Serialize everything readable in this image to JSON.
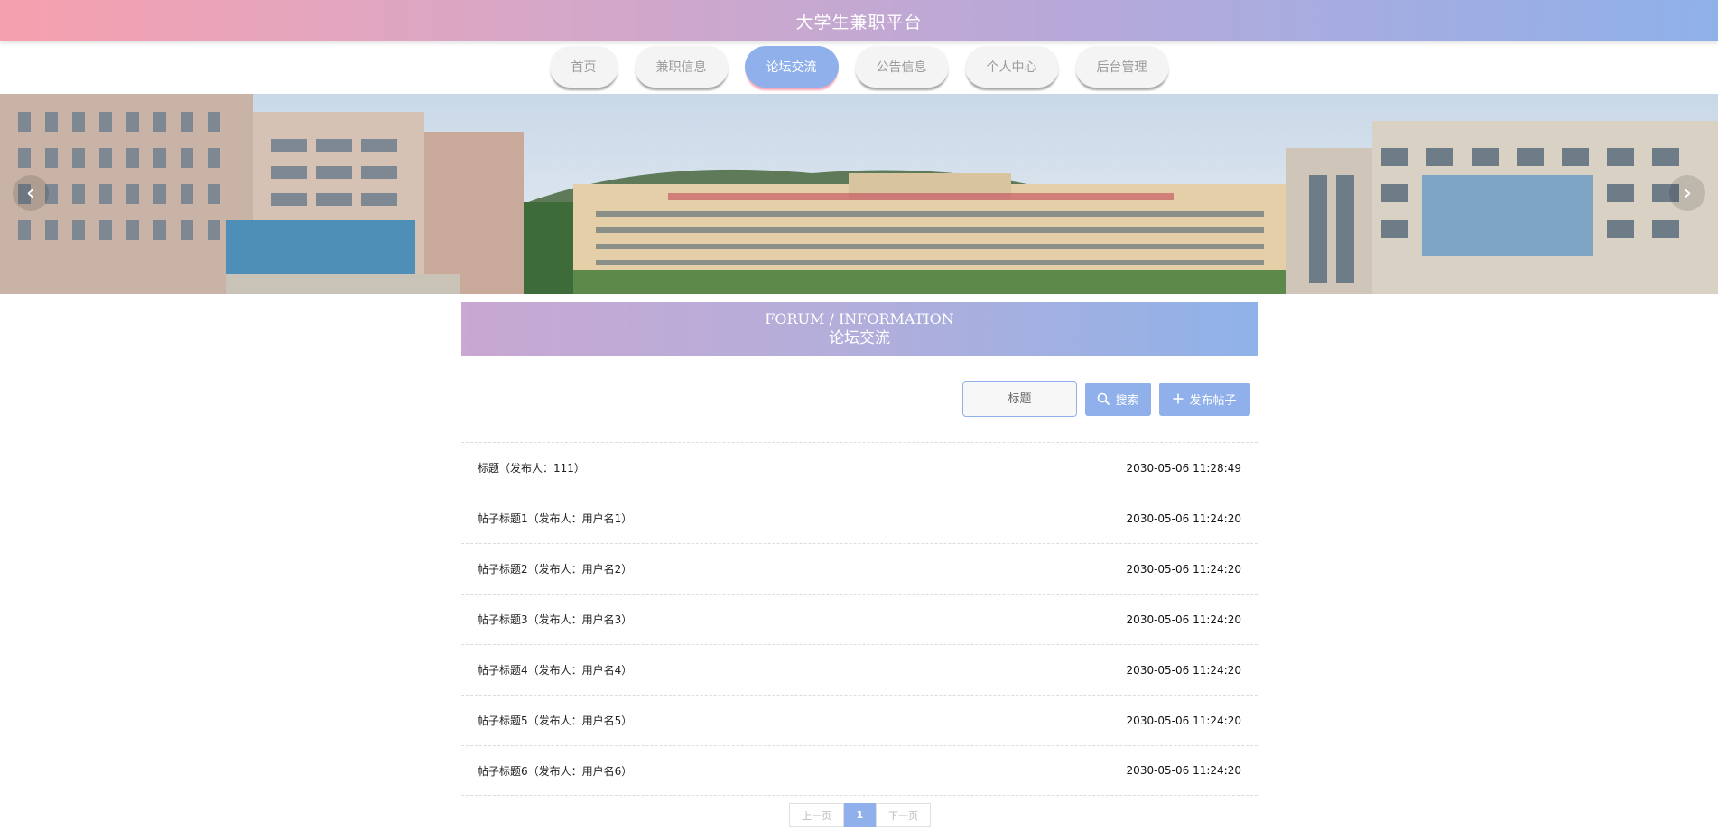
{
  "header": {
    "title": "大学生兼职平台"
  },
  "nav": {
    "items": [
      {
        "label": "首页"
      },
      {
        "label": "兼职信息"
      },
      {
        "label": "论坛交流"
      },
      {
        "label": "公告信息"
      },
      {
        "label": "个人中心"
      },
      {
        "label": "后台管理"
      }
    ],
    "active_index": 2
  },
  "banner": {
    "prev_glyph": "‹",
    "next_glyph": "›"
  },
  "section": {
    "title_en": "FORUM / INFORMATION",
    "title_cn": "论坛交流"
  },
  "search": {
    "placeholder": "标题",
    "search_label": "搜索",
    "post_label": "发布帖子"
  },
  "posts": [
    {
      "title": "标题（发布人：111）",
      "time": "2030-05-06 11:28:49"
    },
    {
      "title": "帖子标题1（发布人：用户名1）",
      "time": "2030-05-06 11:24:20"
    },
    {
      "title": "帖子标题2（发布人：用户名2）",
      "time": "2030-05-06 11:24:20"
    },
    {
      "title": "帖子标题3（发布人：用户名3）",
      "time": "2030-05-06 11:24:20"
    },
    {
      "title": "帖子标题4（发布人：用户名4）",
      "time": "2030-05-06 11:24:20"
    },
    {
      "title": "帖子标题5（发布人：用户名5）",
      "time": "2030-05-06 11:24:20"
    },
    {
      "title": "帖子标题6（发布人：用户名6）",
      "time": "2030-05-06 11:24:20"
    }
  ],
  "pager": {
    "prev": "上一页",
    "current": "1",
    "next": "下一页"
  },
  "colors": {
    "accent": "#8fb0ea",
    "pink": "#f6a0ae"
  }
}
